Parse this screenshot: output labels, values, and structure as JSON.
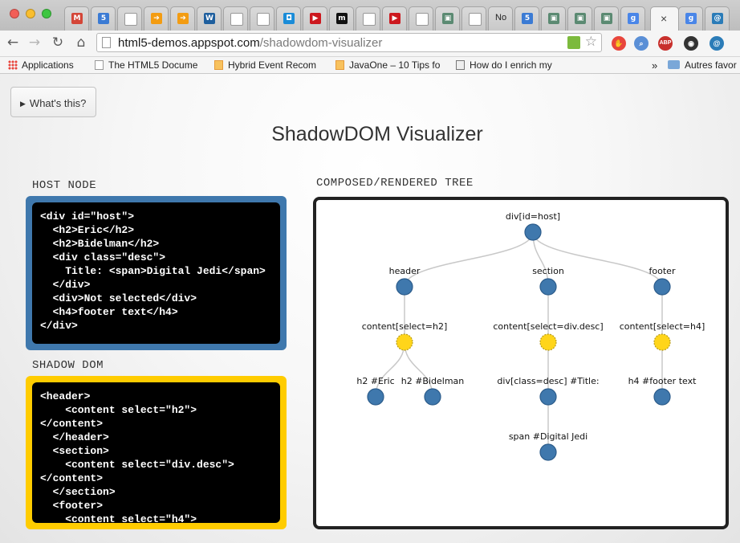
{
  "browser": {
    "tabs": [
      {
        "icon": "gmail-icon",
        "color": "#d44638",
        "glyph": "M",
        "title": ""
      },
      {
        "icon": "html5-icon",
        "color": "#3b7bd4",
        "glyph": "5",
        "title": ""
      },
      {
        "icon": "page-icon",
        "color": "#ffffff",
        "glyph": "",
        "title": ""
      },
      {
        "icon": "arrow-icon",
        "color": "#f39c12",
        "glyph": "➔",
        "title": ""
      },
      {
        "icon": "arrow-icon",
        "color": "#f39c12",
        "glyph": "➔",
        "title": ""
      },
      {
        "icon": "w3c-icon",
        "color": "#1f5f9e",
        "glyph": "W",
        "title": ""
      },
      {
        "icon": "page-icon",
        "color": "#ffffff",
        "glyph": "",
        "title": ""
      },
      {
        "icon": "page-icon",
        "color": "#ffffff",
        "glyph": "",
        "title": ""
      },
      {
        "icon": "chat-icon",
        "color": "#1a8cd8",
        "glyph": "◘",
        "title": ""
      },
      {
        "icon": "youtube-icon",
        "color": "#cc181e",
        "glyph": "▶",
        "title": ""
      },
      {
        "icon": "m-icon",
        "color": "#111111",
        "glyph": "m",
        "title": ""
      },
      {
        "icon": "page-icon",
        "color": "#ffffff",
        "glyph": "",
        "title": ""
      },
      {
        "icon": "youtube-icon",
        "color": "#cc181e",
        "glyph": "▶",
        "title": ""
      },
      {
        "icon": "page-icon",
        "color": "#ffffff",
        "glyph": "",
        "title": ""
      },
      {
        "icon": "robot-icon",
        "color": "#5b8a72",
        "glyph": "▣",
        "title": ""
      },
      {
        "icon": "page-icon",
        "color": "#ffffff",
        "glyph": "",
        "title": ""
      },
      {
        "icon": "",
        "color": "transparent",
        "glyph": "",
        "title": "No"
      },
      {
        "icon": "html5-icon",
        "color": "#3b7bd4",
        "glyph": "5",
        "title": ""
      },
      {
        "icon": "robot-icon",
        "color": "#5b8a72",
        "glyph": "▣",
        "title": ""
      },
      {
        "icon": "robot-icon",
        "color": "#5b8a72",
        "glyph": "▣",
        "title": ""
      },
      {
        "icon": "robot-icon",
        "color": "#5b8a72",
        "glyph": "▣",
        "title": ""
      },
      {
        "icon": "google-icon",
        "color": "#4a86e8",
        "glyph": "g",
        "title": ""
      },
      {
        "icon": "close-icon",
        "color": "",
        "glyph": "",
        "title": "",
        "active": true
      },
      {
        "icon": "google-icon",
        "color": "#4a86e8",
        "glyph": "g",
        "title": ""
      },
      {
        "icon": "swirl-icon",
        "color": "#2b7cb8",
        "glyph": "@",
        "title": ""
      }
    ],
    "active_tab_close": "×",
    "back": "←",
    "forward": "→",
    "reload": "↻",
    "home": "⌂",
    "url_host": "html5-demos.appspot.com",
    "url_path": "/shadowdom-visualizer",
    "star": "☆",
    "extensions": [
      {
        "name": "stop-extension-icon",
        "color": "#e8453c",
        "glyph": "✋"
      },
      {
        "name": "magnifier-extension-icon",
        "color": "#5a8fd6",
        "glyph": "⌕"
      },
      {
        "name": "adblock-extension-icon",
        "color": "#c8302c",
        "glyph": "ABP"
      },
      {
        "name": "record-extension-icon",
        "color": "#333333",
        "glyph": "◉"
      },
      {
        "name": "swirl-extension-icon",
        "color": "#2b7cb8",
        "glyph": "@"
      }
    ],
    "bookmarks": {
      "apps": "Applications",
      "items": [
        "The HTML5 Docume",
        "Hybrid Event Recom",
        "JavaOne – 10 Tips fo",
        "How do I enrich my"
      ],
      "overflow": "»",
      "others": "Autres favor"
    }
  },
  "page": {
    "whats_this": "What's this?",
    "title": "ShadowDOM Visualizer",
    "host_label": "HOST NODE",
    "shadow_label": "SHADOW DOM",
    "tree_label": "COMPOSED/RENDERED TREE",
    "host_code": "<div id=\"host\">\n  <h2>Eric</h2>\n  <h2>Bidelman</h2>\n  <div class=\"desc\">\n    Title: <span>Digital Jedi</span>\n  </div>\n  <div>Not selected</div>\n  <h4>footer text</h4>\n</div>",
    "shadow_code": "<header>\n    <content select=\"h2\">\n</content>\n  </header>\n  <section>\n    <content select=\"div.desc\">\n</content>\n  </section>\n  <footer>\n    <content select=\"h4\">"
  },
  "tree": {
    "colors": {
      "element": "#3f78ad",
      "content": "#ffd51a"
    },
    "nodes": [
      {
        "id": "root",
        "label": "div[id=host]",
        "kind": "element"
      },
      {
        "id": "header",
        "label": "header",
        "kind": "element"
      },
      {
        "id": "section",
        "label": "section",
        "kind": "element"
      },
      {
        "id": "footer",
        "label": "footer",
        "kind": "element"
      },
      {
        "id": "c1",
        "label": "content[select=h2]",
        "kind": "content"
      },
      {
        "id": "c2",
        "label": "content[select=div.desc]",
        "kind": "content"
      },
      {
        "id": "c3",
        "label": "content[select=h4]",
        "kind": "content"
      },
      {
        "id": "h2a",
        "label": "h2 #Eric",
        "kind": "element"
      },
      {
        "id": "h2b",
        "label": "h2 #Bidelman",
        "kind": "element"
      },
      {
        "id": "desc",
        "label": "div[class=desc] #Title:",
        "kind": "element"
      },
      {
        "id": "h4",
        "label": "h4 #footer text",
        "kind": "element"
      },
      {
        "id": "span",
        "label": "span #Digital Jedi",
        "kind": "element"
      }
    ],
    "edges": [
      [
        "root",
        "header"
      ],
      [
        "root",
        "section"
      ],
      [
        "root",
        "footer"
      ],
      [
        "header",
        "c1"
      ],
      [
        "section",
        "c2"
      ],
      [
        "footer",
        "c3"
      ],
      [
        "c1",
        "h2a"
      ],
      [
        "c1",
        "h2b"
      ],
      [
        "c2",
        "desc"
      ],
      [
        "c3",
        "h4"
      ],
      [
        "desc",
        "span"
      ]
    ]
  }
}
